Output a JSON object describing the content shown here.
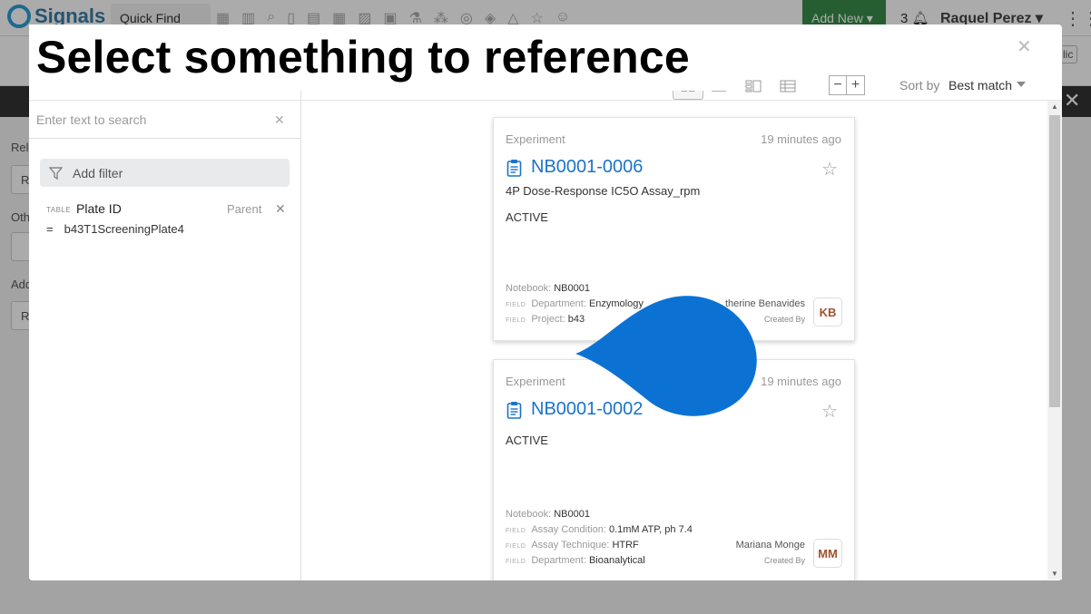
{
  "app": {
    "logo_text": "Signals",
    "quick_find": "Quick Find",
    "add_new": "Add New",
    "notification_count": "3",
    "user_name": "Raquel Perez",
    "public_tag": "lic",
    "bg_labels": [
      "Rel",
      "Oth",
      "Add"
    ],
    "bg_field_text": [
      "R",
      "R"
    ]
  },
  "headline": "Select something to reference",
  "modal": {
    "search": {
      "placeholder": "Enter text to search",
      "value": ""
    },
    "add_filter_label": "Add filter",
    "filter": {
      "kind": "TABLE",
      "name": "Plate ID",
      "scope": "Parent",
      "operator": "=",
      "value": "b43T1ScreeningPlate4"
    },
    "sort": {
      "label": "Sort by",
      "value": "Best match"
    },
    "cards": [
      {
        "type": "Experiment",
        "time": "19 minutes ago",
        "id": "NB0001-0006",
        "description": "4P Dose-Response IC5O Assay_rpm",
        "status": "ACTIVE",
        "notebook_label": "Notebook:",
        "notebook": "NB0001",
        "fields": [
          {
            "tag": "FIELD",
            "label": "Department:",
            "value": "Enzymology"
          },
          {
            "tag": "FIELD",
            "label": "Project:",
            "value": "b43"
          }
        ],
        "creator": "therine Benavides",
        "created_by_label": "Created By",
        "initials": "KB"
      },
      {
        "type": "Experiment",
        "time": "19 minutes ago",
        "id": "NB0001-0002",
        "description": "",
        "status": "ACTIVE",
        "notebook_label": "Notebook:",
        "notebook": "NB0001",
        "fields": [
          {
            "tag": "FIELD",
            "label": "Assay Condition:",
            "value": "0.1mM ATP, ph 7.4"
          },
          {
            "tag": "FIELD",
            "label": "Assay Technique:",
            "value": "HTRF"
          },
          {
            "tag": "FIELD",
            "label": "Department:",
            "value": "Bioanalytical"
          }
        ],
        "creator": "Mariana Monge",
        "created_by_label": "Created By",
        "initials": "MM"
      }
    ]
  },
  "colors": {
    "link": "#1a73c9",
    "pointer": "#0b72d4",
    "add_new": "#3a8d4a"
  }
}
